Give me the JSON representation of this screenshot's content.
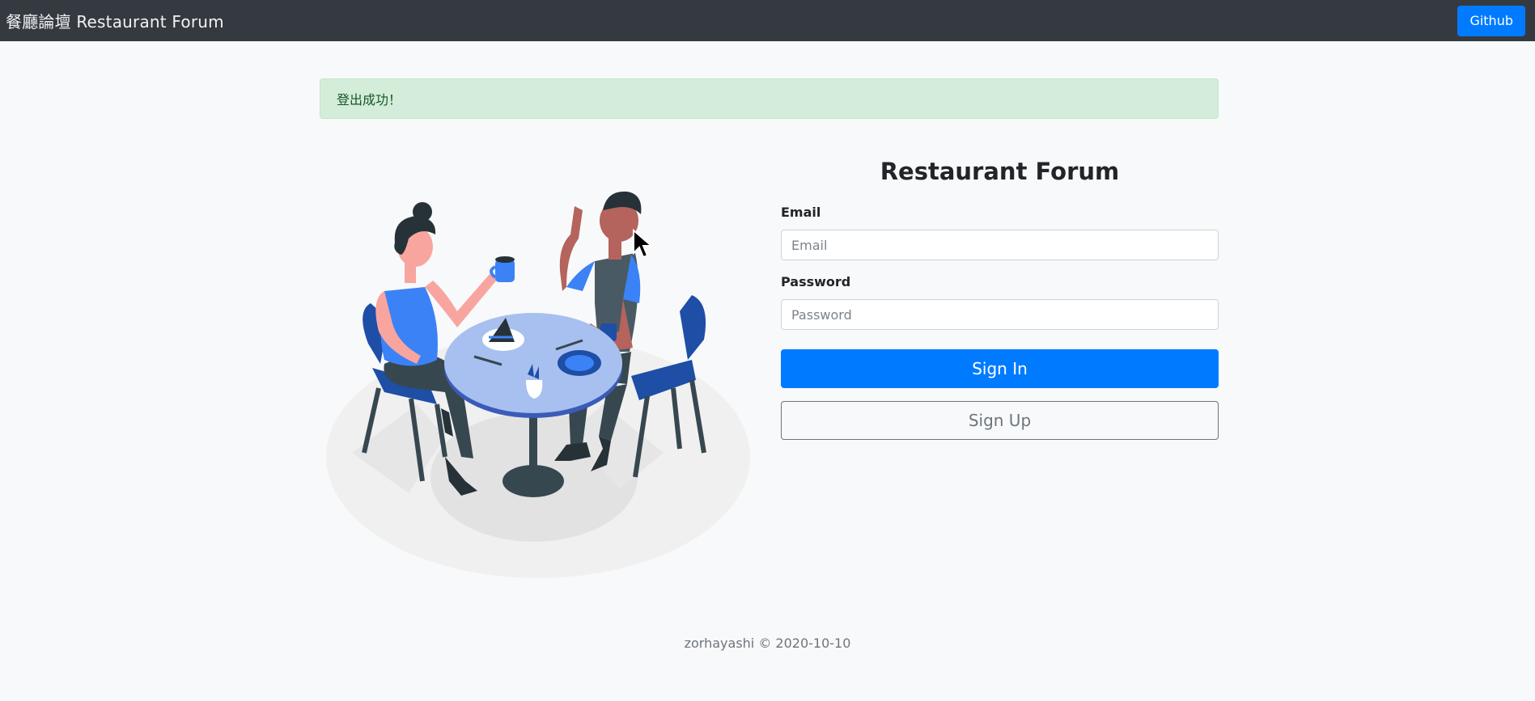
{
  "navbar": {
    "brand": "餐廳論壇 Restaurant Forum",
    "github_label": "Github"
  },
  "alert": {
    "message": "登出成功！"
  },
  "form": {
    "title": "Restaurant Forum",
    "email_label": "Email",
    "email_placeholder": "Email",
    "email_value": "",
    "password_label": "Password",
    "password_placeholder": "Password",
    "password_value": "",
    "signin_label": "Sign In",
    "signup_label": "Sign Up"
  },
  "footer": {
    "text": "zorhayashi © 2020-10-10"
  },
  "colors": {
    "navbar": "#343a40",
    "primary": "#007bff",
    "alert_bg": "#d4edda",
    "alert_text": "#155724",
    "secondary": "#6c757d"
  },
  "icons": {
    "illustration": "couple-at-cafe-illustration",
    "cursor": "mouse-pointer-icon"
  }
}
